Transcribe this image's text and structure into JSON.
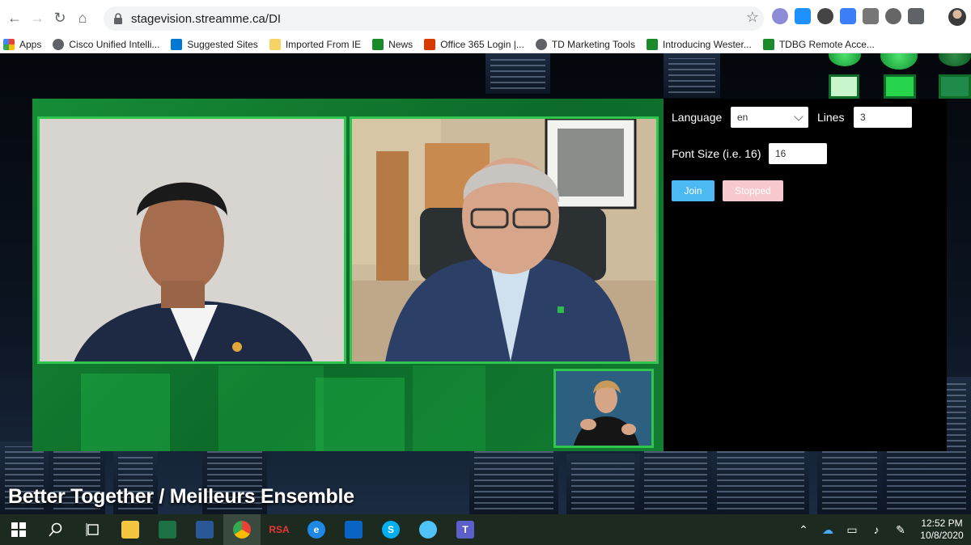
{
  "browser": {
    "url": "stagevision.streamme.ca/DI",
    "nav_icons": {
      "back": "←",
      "forward": "→",
      "reload": "↻",
      "home": "⌂"
    },
    "star": "☆"
  },
  "bookmarks": [
    {
      "label": "Apps",
      "icon_color": "#ea4335"
    },
    {
      "label": "Cisco Unified Intelli...",
      "icon_color": "#5f6368"
    },
    {
      "label": "Suggested Sites",
      "icon_color": "#0078d4"
    },
    {
      "label": "Imported From IE",
      "icon_color": "#f6d365"
    },
    {
      "label": "News",
      "icon_color": "#1a8a2b"
    },
    {
      "label": "Office 365 Login |...",
      "icon_color": "#d83b01"
    },
    {
      "label": "TD Marketing Tools",
      "icon_color": "#5f6368"
    },
    {
      "label": "Introducing Wester...",
      "icon_color": "#1a8a2b"
    },
    {
      "label": "TDBG Remote Acce...",
      "icon_color": "#1a8a2b"
    }
  ],
  "panel": {
    "language_label": "Language",
    "language_value": "en",
    "lines_label": "Lines",
    "lines_value": "3",
    "font_size_label": "Font Size (i.e. 16)",
    "font_size_value": "16",
    "join_label": "Join",
    "stopped_label": "Stopped"
  },
  "event_title": "Better Together / Meilleurs Ensemble",
  "taskbar": {
    "time": "12:52 PM",
    "date": "10/8/2020"
  },
  "colors": {
    "stage_green": "#168c37",
    "video_border": "#2fc54f",
    "join_blue": "#4cb9f2",
    "stopped_pink": "#f7c9cf"
  }
}
